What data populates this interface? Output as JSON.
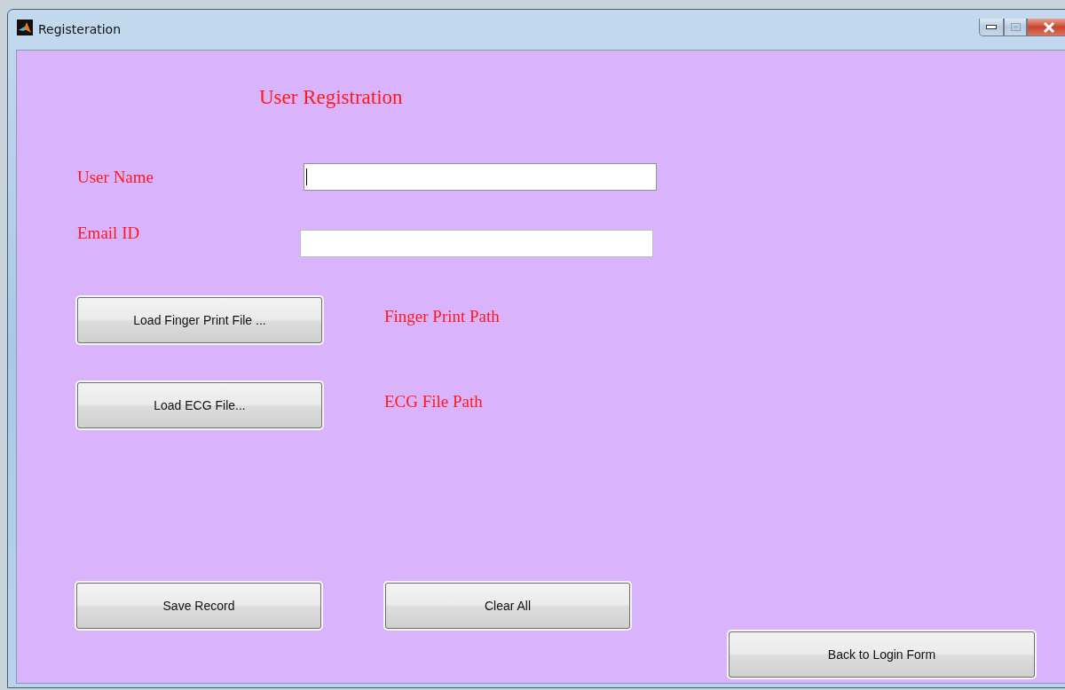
{
  "window": {
    "title": "Registeration"
  },
  "heading": "User Registration",
  "fields": [
    {
      "label": "User Name",
      "focused": true
    },
    {
      "label": "Email ID",
      "focused": false
    }
  ],
  "file_rows": [
    {
      "button": "Load Finger Print File ...",
      "path": "Finger Print Path"
    },
    {
      "button": "Load ECG File...",
      "path": "ECG File Path"
    }
  ],
  "actions": [
    "Save Record",
    "Clear All"
  ],
  "back_button": "Back to Login Form"
}
